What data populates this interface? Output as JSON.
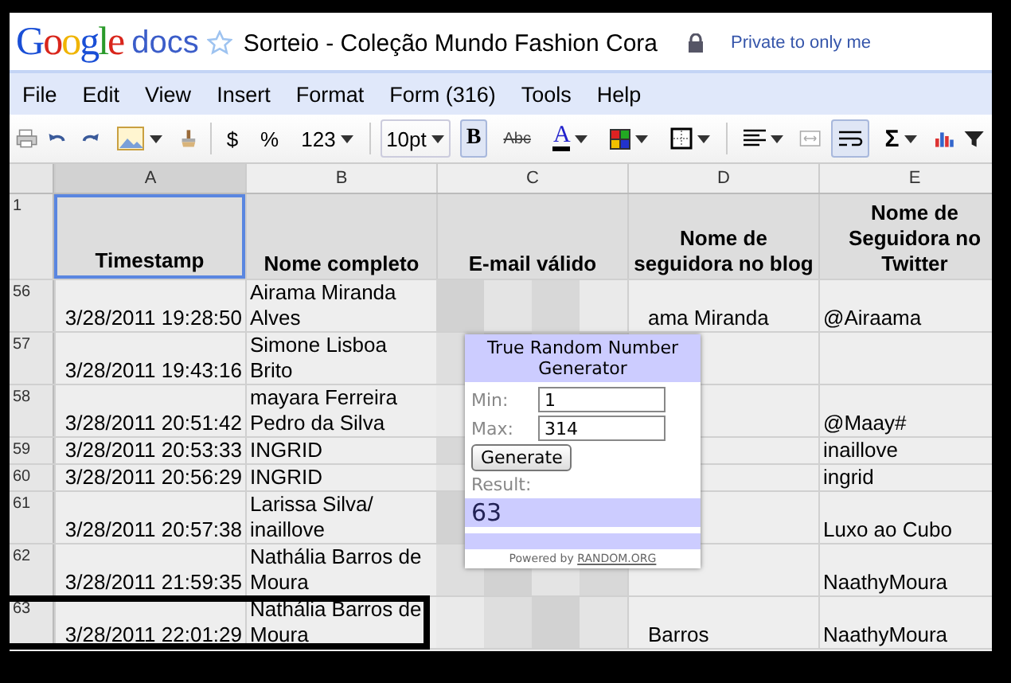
{
  "header": {
    "logo": "Google",
    "product": "docs",
    "title": "Sorteio - Coleção Mundo Fashion Cora",
    "starred": false,
    "privacy": "Private to only me"
  },
  "menu": [
    "File",
    "Edit",
    "View",
    "Insert",
    "Format",
    "Form (316)",
    "Tools",
    "Help"
  ],
  "toolbar": {
    "currency": "$",
    "percent": "%",
    "number_format": "123",
    "font_size": "10pt",
    "bold": {
      "label": "B",
      "selected": true
    },
    "strikethrough": "Abc",
    "text_color": "A",
    "sum": "Σ",
    "wrap_text": {
      "selected": true
    }
  },
  "sheet": {
    "columns": [
      {
        "label": "A",
        "selected": true
      },
      {
        "label": "B",
        "selected": false
      },
      {
        "label": "C",
        "selected": false
      },
      {
        "label": "D",
        "selected": false
      },
      {
        "label": "E",
        "selected": false
      }
    ],
    "header_row": {
      "number": "1",
      "cells": [
        "Timestamp",
        "Nome completo",
        "E-mail válido",
        "Nome de seguidora no blog",
        "Nome de Seguidora no Twitter"
      ]
    },
    "rows": [
      {
        "number": "56",
        "timestamp": "3/28/2011 19:28:50",
        "name": "Airama Miranda Alves",
        "blog": "ama Miranda",
        "twitter": "@Airaama",
        "highlighted": false
      },
      {
        "number": "57",
        "timestamp": "3/28/2011 19:43:16",
        "name": "Simone Lisboa Brito",
        "blog": "",
        "twitter": "",
        "highlighted": false
      },
      {
        "number": "58",
        "timestamp": "3/28/2011 20:51:42",
        "name": "mayara Ferreira Pedro da Silva",
        "blog": "",
        "twitter": "@Maay#",
        "highlighted": false
      },
      {
        "number": "59",
        "timestamp": "3/28/2011 20:53:33",
        "name": "INGRID",
        "blog": "",
        "twitter": "inaillove",
        "highlighted": false
      },
      {
        "number": "60",
        "timestamp": "3/28/2011 20:56:29",
        "name": "INGRID",
        "blog": "",
        "twitter": "ingrid",
        "highlighted": false
      },
      {
        "number": "61",
        "timestamp": "3/28/2011 20:57:38",
        "name": "Larissa Silva/ inaillove",
        "blog": "",
        "twitter": "Luxo ao Cubo",
        "highlighted": false
      },
      {
        "number": "62",
        "timestamp": "3/28/2011 21:59:35",
        "name": "Nathália Barros de Moura",
        "blog": "",
        "twitter": "NaathyMoura",
        "highlighted": false
      },
      {
        "number": "63",
        "timestamp": "3/28/2011 22:01:29",
        "name": "Nathália Barros de Moura",
        "blog": "Barros",
        "twitter": "NaathyMoura",
        "highlighted": true
      }
    ]
  },
  "widget": {
    "title": "True Random Number Generator",
    "min_label": "Min:",
    "min": "1",
    "max_label": "Max:",
    "max": "314",
    "button": "Generate",
    "result_label": "Result:",
    "result": "63",
    "powered_by": "Powered by",
    "powered_link": "RANDOM.ORG"
  }
}
